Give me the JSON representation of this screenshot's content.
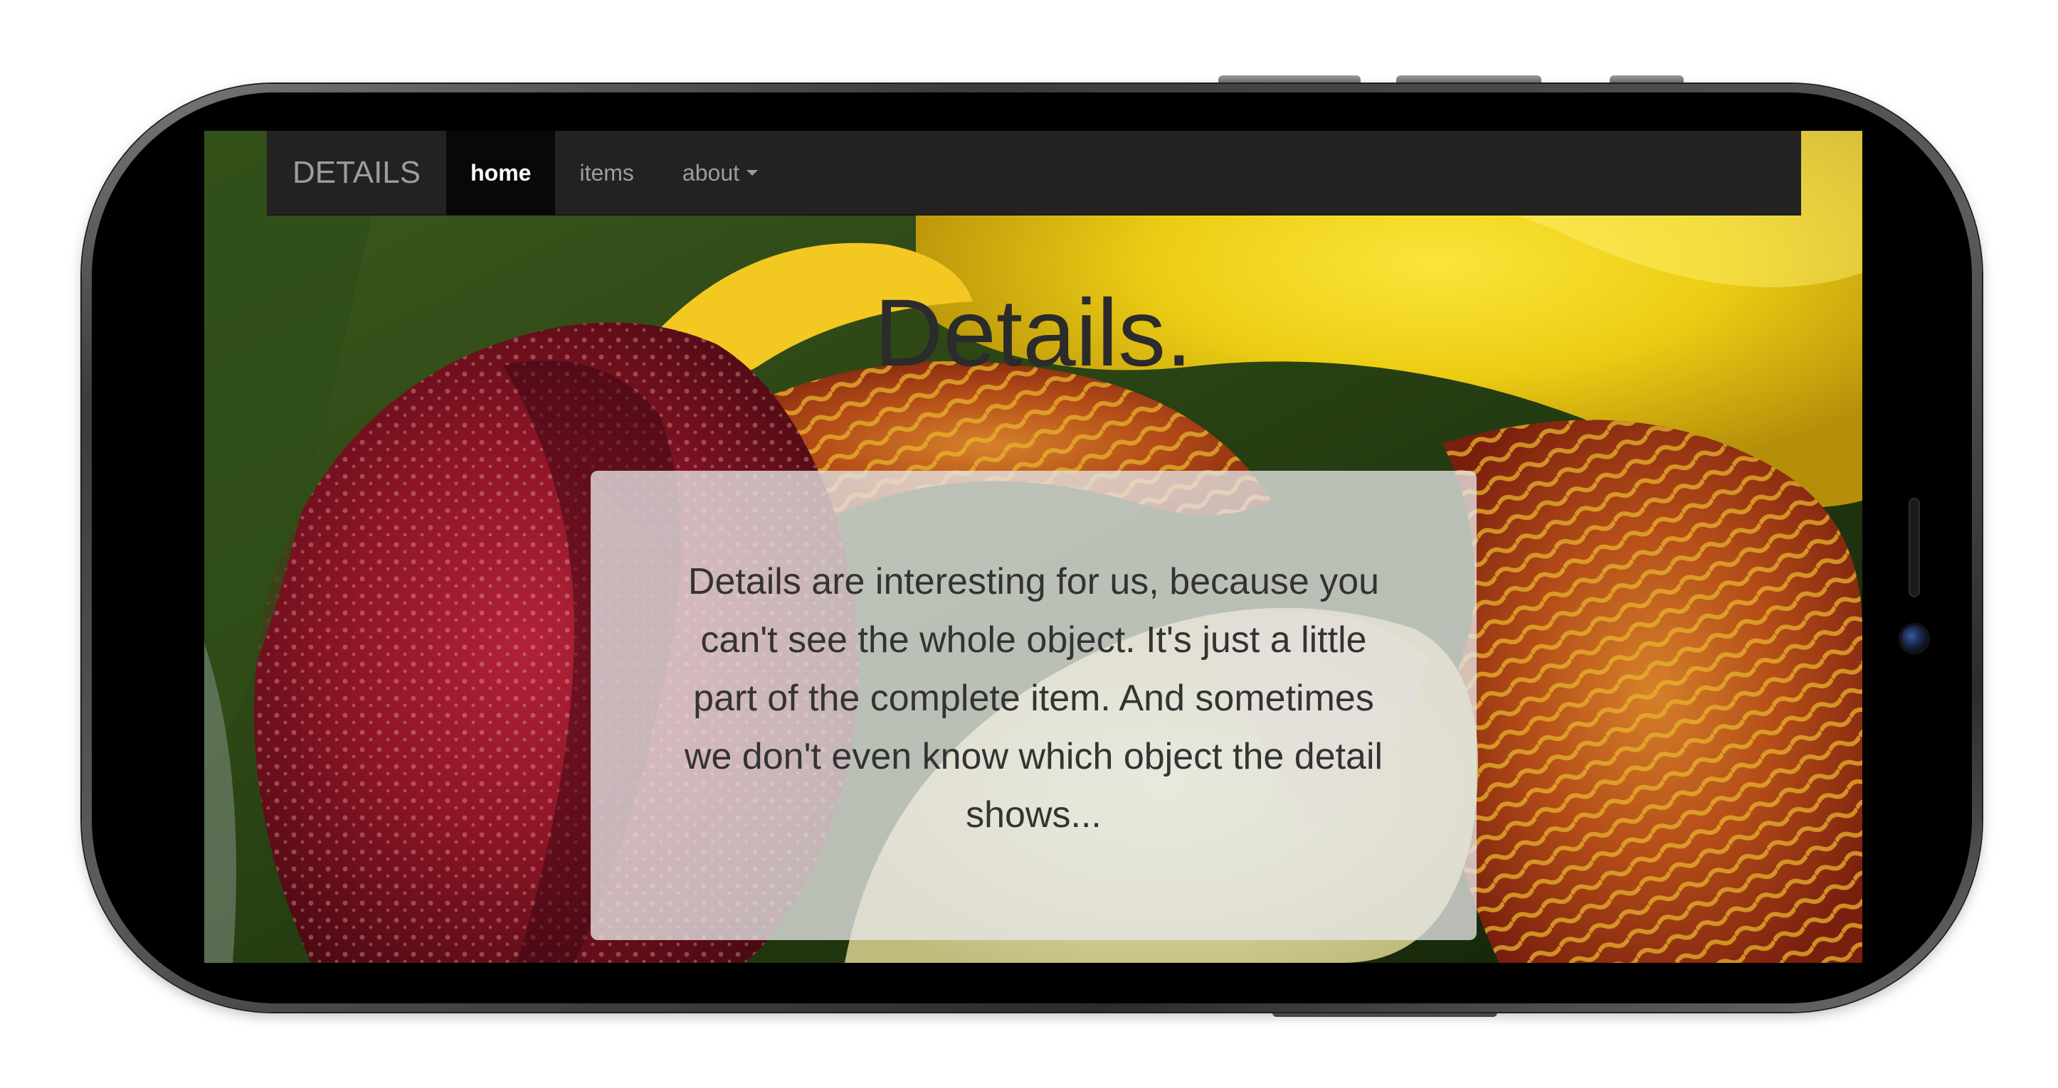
{
  "navbar": {
    "brand": "DETAILS",
    "items": [
      {
        "label": "home",
        "active": true
      },
      {
        "label": "items",
        "active": false
      },
      {
        "label": "about",
        "active": false,
        "dropdown": true
      }
    ]
  },
  "hero": {
    "title": "Details.",
    "text": "Details are interesting for us, because you can't see the whole object. It's just a little part of the complete item. And sometimes we don't even know which object the detail shows..."
  },
  "colors": {
    "navbar_bg": "#222222",
    "active_item_bg": "#080808",
    "nav_text": "#9d9d9d",
    "active_text": "#ffffff",
    "title_text": "#2b2b2b",
    "box_bg": "#e6e6e6"
  },
  "background_image": "iris-flower-photo"
}
